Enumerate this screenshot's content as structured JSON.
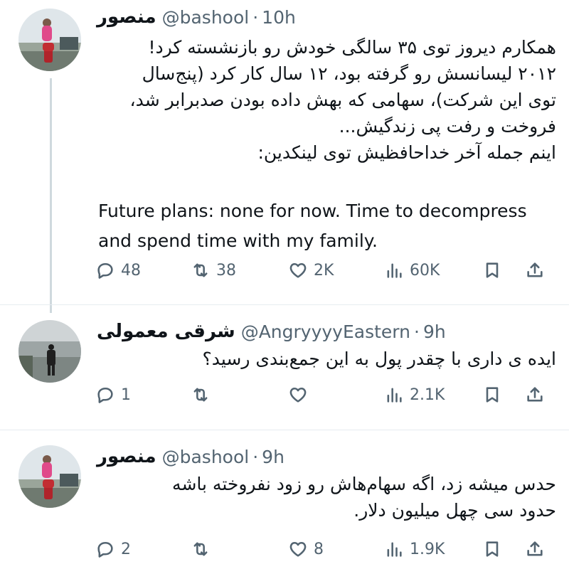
{
  "tweets": [
    {
      "name": "منصور",
      "handle": "@bashool",
      "separator": "·",
      "time": "10h",
      "text_lines": [
        "همکارم دیروز توی ۳۵ سالگی خودش رو بازنشسته کرد!",
        "۲۰۱۲ لیسانسش رو گرفته بود، ۱۲ سال کار کرد (پنج‌سال",
        "توی این شرکت)، سهامی که بهش داده بودن صدبرابر شد،",
        "فروخت و رفت پی زندگیش...",
        "اینم جمله آخر خداحافظیش توی لینکدین:"
      ],
      "quote_lines": [
        "Future plans: none for now. Time to decompress",
        "and spend time with my family."
      ],
      "replies": "48",
      "retweets": "38",
      "likes": "2K",
      "views": "60K"
    },
    {
      "name": "شرقی معمولی",
      "handle": "@AngryyyyEastern",
      "separator": "·",
      "time": "9h",
      "text_lines": [
        "ایده ی داری با چقدر پول به این جمع‌بندی رسید؟"
      ],
      "replies": "1",
      "retweets": "",
      "likes": "",
      "views": "2.1K"
    },
    {
      "name": "منصور",
      "handle": "@bashool",
      "separator": "·",
      "time": "9h",
      "text_lines": [
        "حدس میشه زد، اگه سهام‌هاش رو زود نفروخته باشه",
        "حدود سی چهل میلیون دلار."
      ],
      "replies": "2",
      "retweets": "",
      "likes": "8",
      "views": "1.9K"
    }
  ],
  "icons": {
    "reply": "reply-icon",
    "retweet": "retweet-icon",
    "like": "heart-icon",
    "views": "views-icon",
    "bookmark": "bookmark-icon",
    "share": "share-icon"
  },
  "colors": {
    "text": "#0f1419",
    "secondary": "#536471",
    "thread_line": "#cfd9de"
  }
}
